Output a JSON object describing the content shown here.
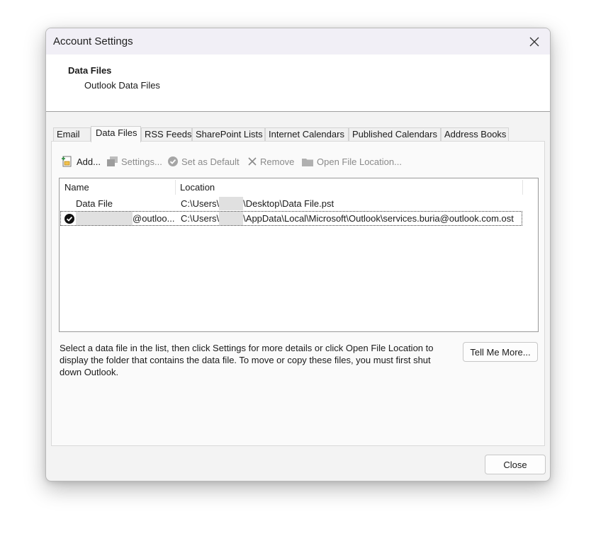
{
  "window": {
    "title": "Account Settings"
  },
  "header": {
    "title": "Data Files",
    "subtitle": "Outlook Data Files"
  },
  "tabs": [
    {
      "label": "Email",
      "active": false
    },
    {
      "label": "Data Files",
      "active": true
    },
    {
      "label": "RSS Feeds",
      "active": false
    },
    {
      "label": "SharePoint Lists",
      "active": false
    },
    {
      "label": "Internet Calendars",
      "active": false
    },
    {
      "label": "Published Calendars",
      "active": false
    },
    {
      "label": "Address Books",
      "active": false
    }
  ],
  "toolbar": {
    "add": "Add...",
    "settings": "Settings...",
    "set_default": "Set as Default",
    "remove": "Remove",
    "open_location": "Open File Location..."
  },
  "list": {
    "columns": {
      "name": "Name",
      "location": "Location"
    },
    "rows": [
      {
        "name": "Data File",
        "location_prefix": "C:\\Users\\",
        "location_suffix": "\\Desktop\\Data File.pst",
        "default": false
      },
      {
        "name_suffix": "@outloo...",
        "location_prefix": "C:\\Users\\",
        "location_suffix": "\\AppData\\Local\\Microsoft\\Outlook\\services.buria@outlook.com.ost",
        "default": true
      }
    ]
  },
  "info_text": "Select a data file in the list, then click Settings for more details or click Open File Location to display the folder that contains the data file. To move or copy these files, you must first shut down Outlook.",
  "buttons": {
    "tell_me_more": "Tell Me More...",
    "close": "Close"
  }
}
